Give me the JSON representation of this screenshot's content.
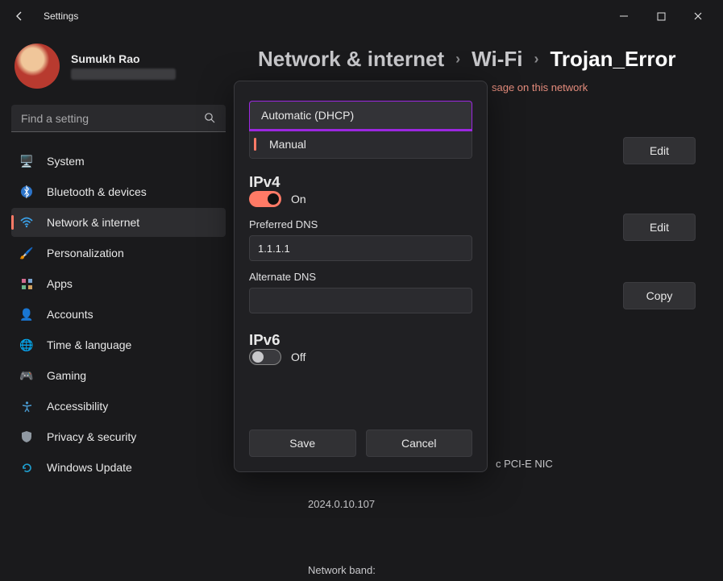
{
  "titlebar": {
    "title": "Settings"
  },
  "user": {
    "name": "Sumukh Rao"
  },
  "search": {
    "placeholder": "Find a setting"
  },
  "nav": {
    "items": [
      {
        "label": "System",
        "icon": "display-icon",
        "color": "#3a8de0"
      },
      {
        "label": "Bluetooth & devices",
        "icon": "bluetooth-icon",
        "color": "#3a8de0"
      },
      {
        "label": "Network & internet",
        "icon": "wifi-icon",
        "color": "#3a8de0",
        "active": true
      },
      {
        "label": "Personalization",
        "icon": "brush-icon",
        "color": "#c18747"
      },
      {
        "label": "Apps",
        "icon": "apps-icon",
        "color": "#d06a8f"
      },
      {
        "label": "Accounts",
        "icon": "person-icon",
        "color": "#6aa36a"
      },
      {
        "label": "Time & language",
        "icon": "globe-icon",
        "color": "#5aa6c8"
      },
      {
        "label": "Gaming",
        "icon": "gamepad-icon",
        "color": "#888"
      },
      {
        "label": "Accessibility",
        "icon": "accessibility-icon",
        "color": "#4a9ad0"
      },
      {
        "label": "Privacy & security",
        "icon": "shield-icon",
        "color": "#9099a2"
      },
      {
        "label": "Windows Update",
        "icon": "update-icon",
        "color": "#1f9fd0"
      }
    ]
  },
  "breadcrumb": {
    "root": "Network & internet",
    "mid": "Wi-Fi",
    "last": "Trojan_Error",
    "sep": "›"
  },
  "content": {
    "warning_suffix": "sage on this network",
    "buttons": {
      "edit": "Edit",
      "copy": "Copy"
    },
    "detail1": "c PCI-E NIC",
    "detail2": "2024.0.10.107",
    "detail3": "Network band:"
  },
  "dialog": {
    "options": {
      "auto": "Automatic (DHCP)",
      "manual": "Manual"
    },
    "ipv4": {
      "heading": "IPv4",
      "toggle_label": "On",
      "preferred_label": "Preferred DNS",
      "preferred_value": "1.1.1.1",
      "alternate_label": "Alternate DNS",
      "alternate_value": ""
    },
    "ipv6": {
      "heading": "IPv6",
      "toggle_label": "Off"
    },
    "save": "Save",
    "cancel": "Cancel"
  }
}
